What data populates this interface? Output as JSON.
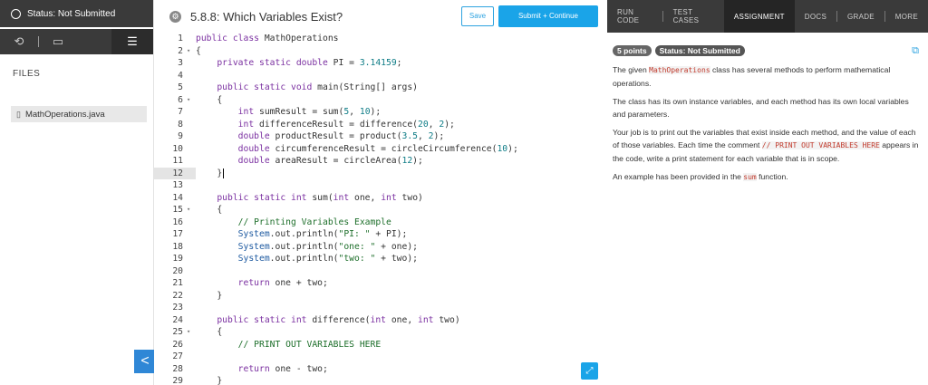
{
  "sidebar": {
    "status": "Status: Not Submitted",
    "files_label": "FILES",
    "file_name": "MathOperations.java",
    "collapse_glyph": "<"
  },
  "header": {
    "exercise_title": "5.8.8: Which Variables Exist?",
    "save_label": "Save",
    "submit_label": "Submit + Continue"
  },
  "code_lines": [
    {
      "n": "1",
      "fold": "",
      "segs": [
        [
          "kw",
          "public class "
        ],
        [
          "",
          "MathOperations"
        ]
      ]
    },
    {
      "n": "2",
      "fold": "▾",
      "segs": [
        [
          "",
          "{"
        ]
      ]
    },
    {
      "n": "3",
      "fold": "",
      "segs": [
        [
          "",
          "    "
        ],
        [
          "kw",
          "private static double "
        ],
        [
          "",
          "PI = "
        ],
        [
          "num",
          "3.14159"
        ],
        [
          "",
          ";"
        ]
      ]
    },
    {
      "n": "4",
      "fold": "",
      "segs": []
    },
    {
      "n": "5",
      "fold": "",
      "segs": [
        [
          "",
          "    "
        ],
        [
          "kw",
          "public static void "
        ],
        [
          "",
          "main(String[] args)"
        ]
      ]
    },
    {
      "n": "6",
      "fold": "▾",
      "segs": [
        [
          "",
          "    {"
        ]
      ]
    },
    {
      "n": "7",
      "fold": "",
      "segs": [
        [
          "",
          "        "
        ],
        [
          "kw",
          "int "
        ],
        [
          "",
          "sumResult = sum("
        ],
        [
          "num",
          "5"
        ],
        [
          "",
          ", "
        ],
        [
          "num",
          "10"
        ],
        [
          "",
          ");"
        ]
      ]
    },
    {
      "n": "8",
      "fold": "",
      "segs": [
        [
          "",
          "        "
        ],
        [
          "kw",
          "int "
        ],
        [
          "",
          "differenceResult = difference("
        ],
        [
          "num",
          "20"
        ],
        [
          "",
          ", "
        ],
        [
          "num",
          "2"
        ],
        [
          "",
          ");"
        ]
      ]
    },
    {
      "n": "9",
      "fold": "",
      "segs": [
        [
          "",
          "        "
        ],
        [
          "kw",
          "double "
        ],
        [
          "",
          "productResult = product("
        ],
        [
          "num",
          "3.5"
        ],
        [
          "",
          ", "
        ],
        [
          "num",
          "2"
        ],
        [
          "",
          ");"
        ]
      ]
    },
    {
      "n": "10",
      "fold": "",
      "segs": [
        [
          "",
          "        "
        ],
        [
          "kw",
          "double "
        ],
        [
          "",
          "circumferenceResult = circleCircumference("
        ],
        [
          "num",
          "10"
        ],
        [
          "",
          ");"
        ]
      ]
    },
    {
      "n": "11",
      "fold": "",
      "segs": [
        [
          "",
          "        "
        ],
        [
          "kw",
          "double "
        ],
        [
          "",
          "areaResult = circleArea("
        ],
        [
          "num",
          "12"
        ],
        [
          "",
          ");"
        ]
      ]
    },
    {
      "n": "12",
      "fold": "",
      "segs": [
        [
          "",
          "    }"
        ],
        [
          "cursor",
          ""
        ]
      ],
      "hl": true
    },
    {
      "n": "13",
      "fold": "",
      "segs": []
    },
    {
      "n": "14",
      "fold": "",
      "segs": [
        [
          "",
          "    "
        ],
        [
          "kw",
          "public static int "
        ],
        [
          "",
          "sum("
        ],
        [
          "kw",
          "int "
        ],
        [
          "",
          "one, "
        ],
        [
          "kw",
          "int "
        ],
        [
          "",
          "two)"
        ]
      ]
    },
    {
      "n": "15",
      "fold": "▾",
      "segs": [
        [
          "",
          "    {"
        ]
      ]
    },
    {
      "n": "16",
      "fold": "",
      "segs": [
        [
          "",
          "        "
        ],
        [
          "cm",
          "// Printing Variables Example"
        ]
      ]
    },
    {
      "n": "17",
      "fold": "",
      "segs": [
        [
          "",
          "        "
        ],
        [
          "obj",
          "System"
        ],
        [
          "",
          ".out.println("
        ],
        [
          "str",
          "\"PI: \""
        ],
        [
          "",
          " + PI);"
        ]
      ]
    },
    {
      "n": "18",
      "fold": "",
      "segs": [
        [
          "",
          "        "
        ],
        [
          "obj",
          "System"
        ],
        [
          "",
          ".out.println("
        ],
        [
          "str",
          "\"one: \""
        ],
        [
          "",
          " + one);"
        ]
      ]
    },
    {
      "n": "19",
      "fold": "",
      "segs": [
        [
          "",
          "        "
        ],
        [
          "obj",
          "System"
        ],
        [
          "",
          ".out.println("
        ],
        [
          "str",
          "\"two: \""
        ],
        [
          "",
          " + two);"
        ]
      ]
    },
    {
      "n": "20",
      "fold": "",
      "segs": []
    },
    {
      "n": "21",
      "fold": "",
      "segs": [
        [
          "",
          "        "
        ],
        [
          "kw",
          "return "
        ],
        [
          "",
          "one + two;"
        ]
      ]
    },
    {
      "n": "22",
      "fold": "",
      "segs": [
        [
          "",
          "    }"
        ]
      ]
    },
    {
      "n": "23",
      "fold": "",
      "segs": []
    },
    {
      "n": "24",
      "fold": "",
      "segs": [
        [
          "",
          "    "
        ],
        [
          "kw",
          "public static int "
        ],
        [
          "",
          "difference("
        ],
        [
          "kw",
          "int "
        ],
        [
          "",
          "one, "
        ],
        [
          "kw",
          "int "
        ],
        [
          "",
          "two)"
        ]
      ]
    },
    {
      "n": "25",
      "fold": "▾",
      "segs": [
        [
          "",
          "    {"
        ]
      ]
    },
    {
      "n": "26",
      "fold": "",
      "segs": [
        [
          "",
          "        "
        ],
        [
          "cm",
          "// PRINT OUT VARIABLES HERE"
        ]
      ]
    },
    {
      "n": "27",
      "fold": "",
      "segs": []
    },
    {
      "n": "28",
      "fold": "",
      "segs": [
        [
          "",
          "        "
        ],
        [
          "kw",
          "return "
        ],
        [
          "",
          "one - two;"
        ]
      ]
    },
    {
      "n": "29",
      "fold": "",
      "segs": [
        [
          "",
          "    }"
        ]
      ]
    }
  ],
  "nav": {
    "tabs": [
      "RUN CODE",
      "TEST CASES",
      "ASSIGNMENT",
      "DOCS",
      "GRADE",
      "MORE"
    ],
    "active": "ASSIGNMENT"
  },
  "assignment": {
    "points": "5 points",
    "status": "Status: Not Submitted",
    "p1_a": "The given ",
    "p1_code": "MathOperations",
    "p1_b": " class has several methods to perform mathematical operations.",
    "p2": "The class has its own instance variables, and each method has its own local variables and parameters.",
    "p3_a": "Your job is to print out the variables that exist inside each method, and the value of each of those variables. Each time the comment ",
    "p3_code": "// PRINT OUT VARIABLES HERE",
    "p3_b": " appears in the code, write a print statement for each variable that is in scope.",
    "p4_a": "An example has been provided in the ",
    "p4_code": "sum",
    "p4_b": " function."
  }
}
